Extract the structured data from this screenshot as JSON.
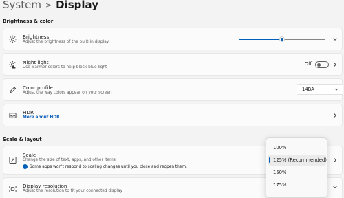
{
  "header": {
    "parent": "System",
    "separator": ">",
    "current": "Display"
  },
  "sections": {
    "brightness_color": "Brightness & color",
    "scale_layout": "Scale & layout"
  },
  "brightness": {
    "title": "Brightness",
    "desc": "Adjust the brightness of the built-in display",
    "level_fraction": 0.5
  },
  "night_light": {
    "title": "Night light",
    "desc": "Use warmer colors to help block blue light",
    "state": "Off"
  },
  "color_profile": {
    "title": "Color profile",
    "desc": "Adjust the way colors appear on your screen",
    "value": "14BA"
  },
  "hdr": {
    "title": "HDR",
    "link": "More about HDR"
  },
  "scale": {
    "title": "Scale",
    "desc": "Change the size of text, apps, and other items",
    "note": "Some apps won't respond to scaling changes until you close and reopen them.",
    "options": [
      "100%",
      "125% (Recommended)",
      "150%",
      "175%"
    ],
    "selected_index": 1
  },
  "resolution": {
    "title": "Display resolution",
    "desc": "Adjust the resolution to fit your connected display"
  },
  "colors": {
    "accent": "#005fb8",
    "link": "#0b5bb8",
    "card_bg": "#fbfbfb",
    "page_bg": "#f3f3f3"
  }
}
